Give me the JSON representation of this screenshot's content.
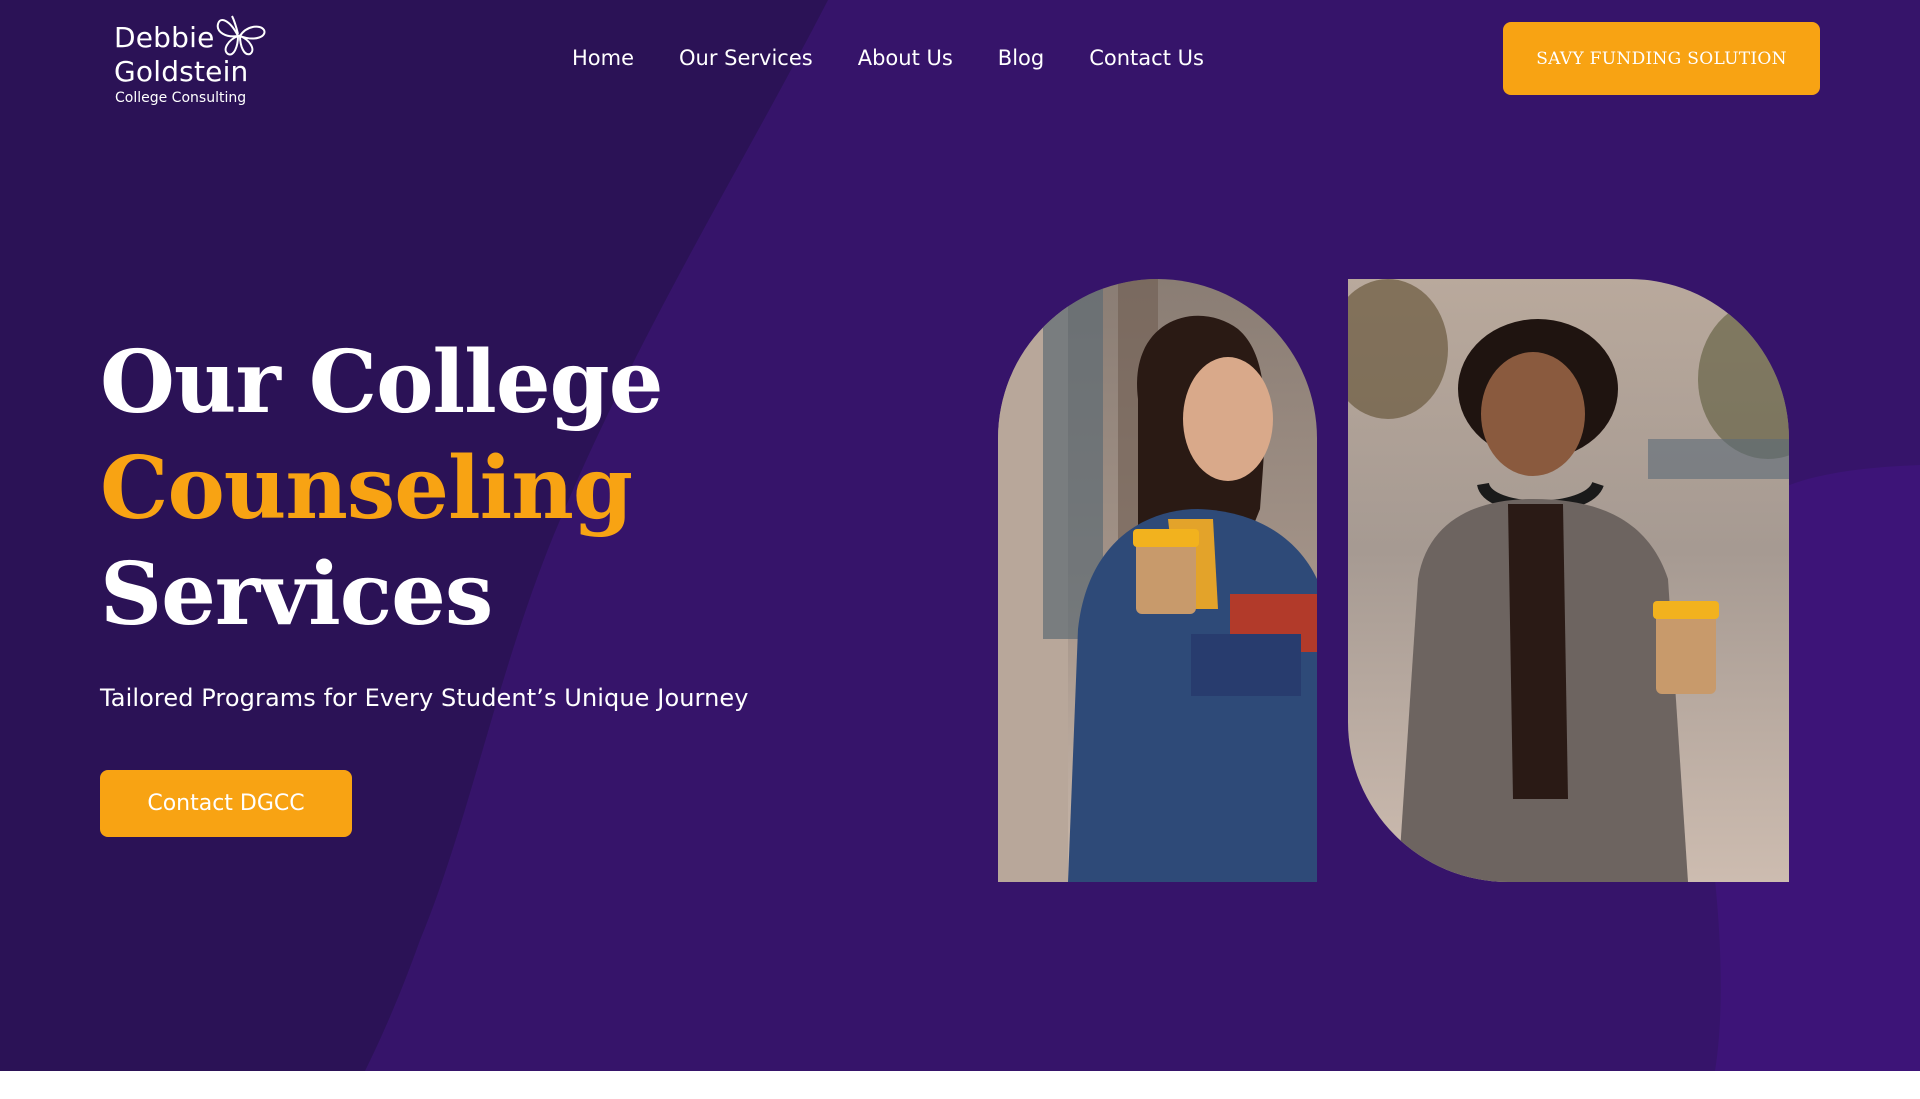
{
  "logo": {
    "line1": "Debbie",
    "line2": "Goldstein",
    "tagline": "College Consulting"
  },
  "nav": {
    "items": [
      "Home",
      "Our Services",
      "About Us",
      "Blog",
      "Contact Us"
    ]
  },
  "header_cta": "SAVY FUNDING SOLUTION",
  "hero": {
    "title_line1": "Our College",
    "title_line2": "Counseling",
    "title_line3": "Services",
    "subtitle": "Tailored Programs for Every Student’s Unique Journey",
    "cta": "Contact DGCC"
  },
  "colors": {
    "background": "#36146a",
    "background_dark": "#2b1256",
    "accent": "#f8a313",
    "text": "#ffffff"
  }
}
